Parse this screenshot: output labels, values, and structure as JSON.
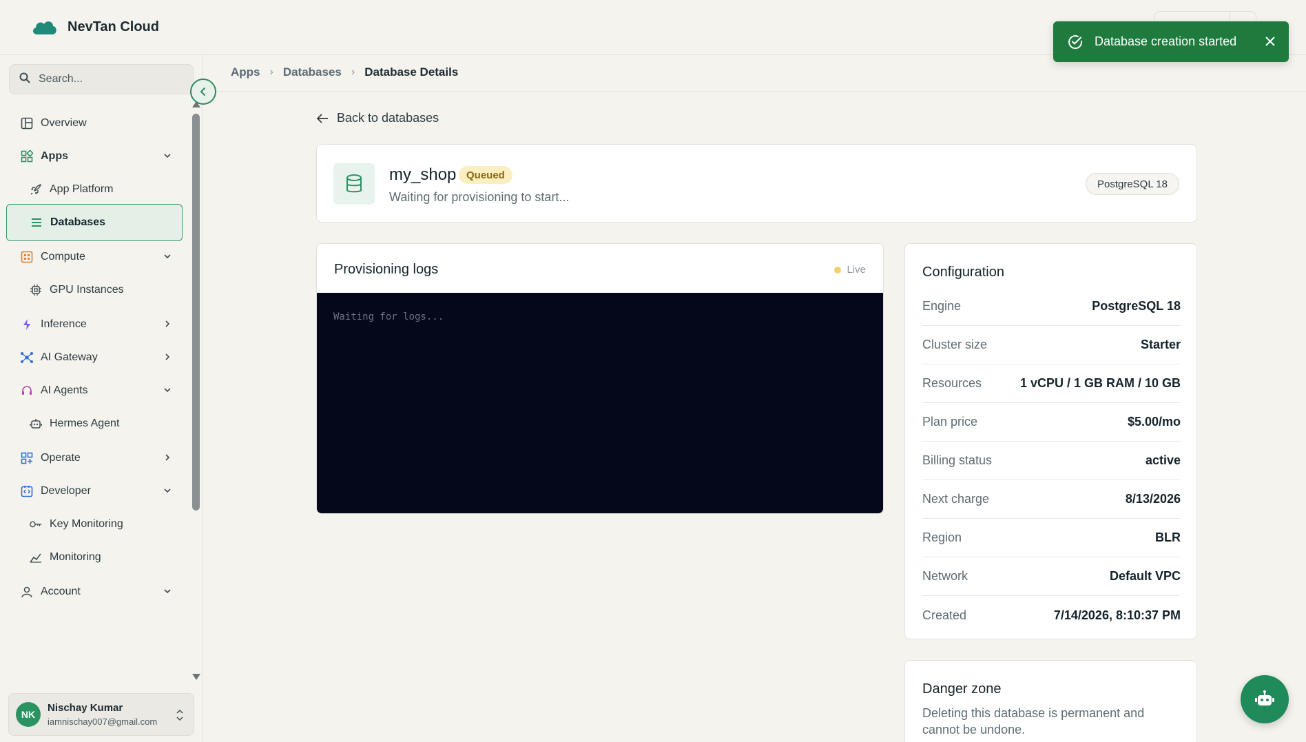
{
  "brand": {
    "name": "NevTan Cloud"
  },
  "sidebar": {
    "search_placeholder": "Search...",
    "items": [
      {
        "label": "Overview",
        "icon": "layout-icon"
      },
      {
        "label": "Apps",
        "icon": "apps-icon",
        "expanded": true
      },
      {
        "label": "App Platform",
        "icon": "rocket-icon"
      },
      {
        "label": "Databases",
        "icon": "list-icon",
        "active": true
      },
      {
        "label": "Compute",
        "icon": "compute-icon",
        "expanded": true
      },
      {
        "label": "GPU Instances",
        "icon": "chip-icon"
      },
      {
        "label": "Inference",
        "icon": "bolt-icon",
        "expanded": false
      },
      {
        "label": "AI Gateway",
        "icon": "network-icon",
        "expanded": false
      },
      {
        "label": "AI Agents",
        "icon": "headset-icon",
        "expanded": true
      },
      {
        "label": "Hermes Agent",
        "icon": "robot-icon"
      },
      {
        "label": "Operate",
        "icon": "grid-plus-icon",
        "expanded": false
      },
      {
        "label": "Developer",
        "icon": "code-icon",
        "expanded": true
      },
      {
        "label": "Key Monitoring",
        "icon": "key-icon"
      },
      {
        "label": "Monitoring",
        "icon": "chart-line-icon"
      },
      {
        "label": "Account",
        "icon": "user-icon",
        "expanded": true
      }
    ],
    "user": {
      "initials": "NK",
      "name": "Nischay Kumar",
      "email": "iamnischay007@gmail.com"
    }
  },
  "breadcrumbs": [
    "Apps",
    "Databases",
    "Database Details"
  ],
  "back_link": "Back to databases",
  "database": {
    "name": "my_shop",
    "status": "Queued",
    "subtitle": "Waiting for provisioning to start...",
    "engine_pill": "PostgreSQL 18"
  },
  "logs": {
    "title": "Provisioning logs",
    "live_label": "Live",
    "placeholder": "Waiting for logs..."
  },
  "configuration": {
    "title": "Configuration",
    "rows": [
      {
        "label": "Engine",
        "value": "PostgreSQL 18"
      },
      {
        "label": "Cluster size",
        "value": "Starter"
      },
      {
        "label": "Resources",
        "value": "1 vCPU / 1 GB RAM / 10 GB"
      },
      {
        "label": "Plan price",
        "value": "$5.00/mo"
      },
      {
        "label": "Billing status",
        "value": "active"
      },
      {
        "label": "Next charge",
        "value": "8/13/2026"
      },
      {
        "label": "Region",
        "value": "BLR"
      },
      {
        "label": "Network",
        "value": "Default VPC"
      },
      {
        "label": "Created",
        "value": "7/14/2026, 8:10:37 PM"
      }
    ]
  },
  "danger_zone": {
    "title": "Danger zone",
    "text": "Deleting this database is permanent and cannot be undone."
  },
  "toast": {
    "message": "Database creation started"
  },
  "colors": {
    "brand_green": "#2b9361",
    "toast_bg": "#1f7a3e",
    "queued_bg": "#fbefc1",
    "queued_text": "#8a6a10",
    "terminal_bg": "#04081a"
  }
}
